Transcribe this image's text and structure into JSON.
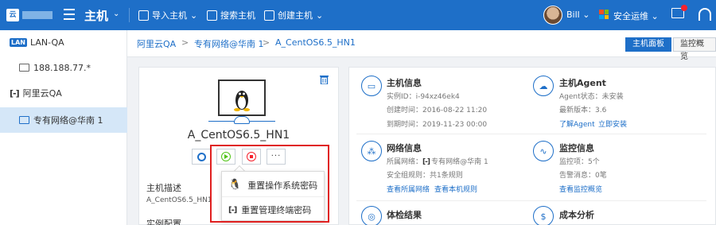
{
  "topbar": {
    "logo_mark": "云",
    "title": "主机",
    "nav": [
      {
        "label": "导入主机",
        "icon": "import-icon"
      },
      {
        "label": "搜索主机",
        "icon": "search-icon"
      },
      {
        "label": "创建主机",
        "icon": "create-icon"
      }
    ],
    "user": "Bill",
    "ops_label": "安全运维",
    "accent": "#1e6fc8"
  },
  "sidebar": {
    "items": [
      {
        "label": "LAN-QA",
        "badge": "LAN"
      },
      {
        "label": "188.188.77.*"
      },
      {
        "label": "阿里云QA"
      },
      {
        "label": "专有网络@华南 1"
      }
    ]
  },
  "breadcrumb": {
    "items": [
      "阿里云QA",
      "专有网络@华南 1",
      "A_CentOS6.5_HN1"
    ],
    "separator": ">"
  },
  "tabs": {
    "active": "主机面板",
    "inactive": "监控概览"
  },
  "host": {
    "name": "A_CentOS6.5_HN1",
    "more_label": "···",
    "desc_label": "主机描述",
    "desc_value": "A_CentOS6.5_HN1",
    "config_label": "实例配置"
  },
  "dropdown": {
    "items": [
      "重置操作系统密码",
      "重置管理终端密码"
    ]
  },
  "info": {
    "host_info": {
      "title": "主机信息",
      "instance_id": "实例ID：i-94xz46ek4",
      "created": "创建时间：2016-08-22 11:20",
      "expires": "到期时间：2019-11-23 00:00"
    },
    "agent": {
      "title": "主机Agent",
      "status": "Agent状态：未安装",
      "version": "最新版本：3.6",
      "link_learn": "了解Agent",
      "link_install": "立即安装"
    },
    "network": {
      "title": "网络信息",
      "belongs_prefix": "所属网络：",
      "belongs_value": "专有网络@华南 1",
      "rules": "安全组规则：共1条规则",
      "link_net": "查看所属网络",
      "link_rules": "查看本机规则"
    },
    "monitor": {
      "title": "监控信息",
      "monitors": "监控项：5个",
      "alerts": "告警消息：0笔",
      "link": "查看监控概览"
    },
    "checkup": {
      "title": "体检结果"
    },
    "cost": {
      "title": "成本分析"
    }
  }
}
